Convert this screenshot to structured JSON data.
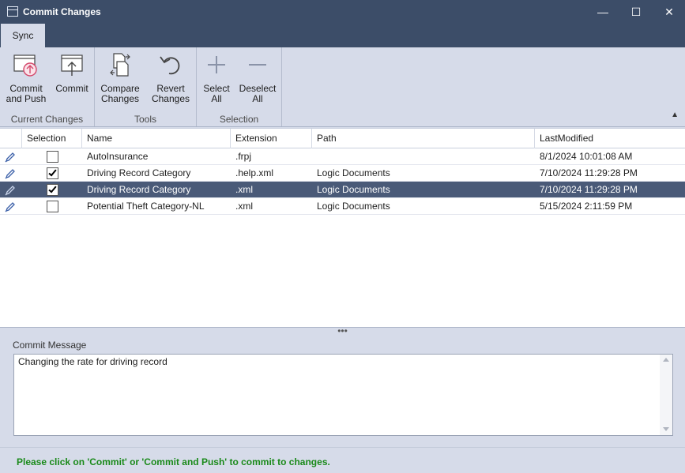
{
  "window": {
    "title": "Commit Changes",
    "minimize": "—",
    "maximize": "☐",
    "close": "✕"
  },
  "ribbon": {
    "tab": "Sync",
    "groups": {
      "current_changes": "Current Changes",
      "tools": "Tools",
      "selection": "Selection"
    },
    "buttons": {
      "commit_push_1": "Commit",
      "commit_push_2": "and Push",
      "commit": "Commit",
      "compare_1": "Compare",
      "compare_2": "Changes",
      "revert_1": "Revert",
      "revert_2": "Changes",
      "select_1": "Select",
      "select_2": "All",
      "deselect_1": "Deselect",
      "deselect_2": "All"
    },
    "collapse": "▲"
  },
  "grid": {
    "headers": {
      "selection": "Selection",
      "name": "Name",
      "extension": "Extension",
      "path": "Path",
      "modified": "LastModified"
    },
    "rows": [
      {
        "name": "AutoInsurance",
        "extension": ".frpj",
        "path": "",
        "modified": "8/1/2024 10:01:08 AM",
        "checked": false,
        "selected": false
      },
      {
        "name": "Driving Record Category",
        "extension": ".help.xml",
        "path": "Logic Documents",
        "modified": "7/10/2024 11:29:28 PM",
        "checked": true,
        "selected": false
      },
      {
        "name": "Driving Record Category",
        "extension": ".xml",
        "path": "Logic Documents",
        "modified": "7/10/2024 11:29:28 PM",
        "checked": true,
        "selected": true
      },
      {
        "name": "Potential Theft Category-NL",
        "extension": ".xml",
        "path": "Logic Documents",
        "modified": "5/15/2024 2:11:59 PM",
        "checked": false,
        "selected": false
      }
    ]
  },
  "splitter": "•••",
  "commit_message": {
    "label": "Commit Message",
    "value": "Changing the rate for driving record"
  },
  "status": "Please click on 'Commit' or 'Commit and Push' to commit to changes.",
  "colors": {
    "titlebar": "#3c4d68",
    "ribbon": "#d6dbe9",
    "selected_row": "#4a5a78",
    "status_text": "#1a8a1a",
    "accent_icon": "#d4486b"
  },
  "icons": [
    "window-icon",
    "commit-push-icon",
    "commit-icon",
    "compare-icon",
    "revert-icon",
    "plus-icon",
    "minus-icon",
    "pencil-icon"
  ]
}
